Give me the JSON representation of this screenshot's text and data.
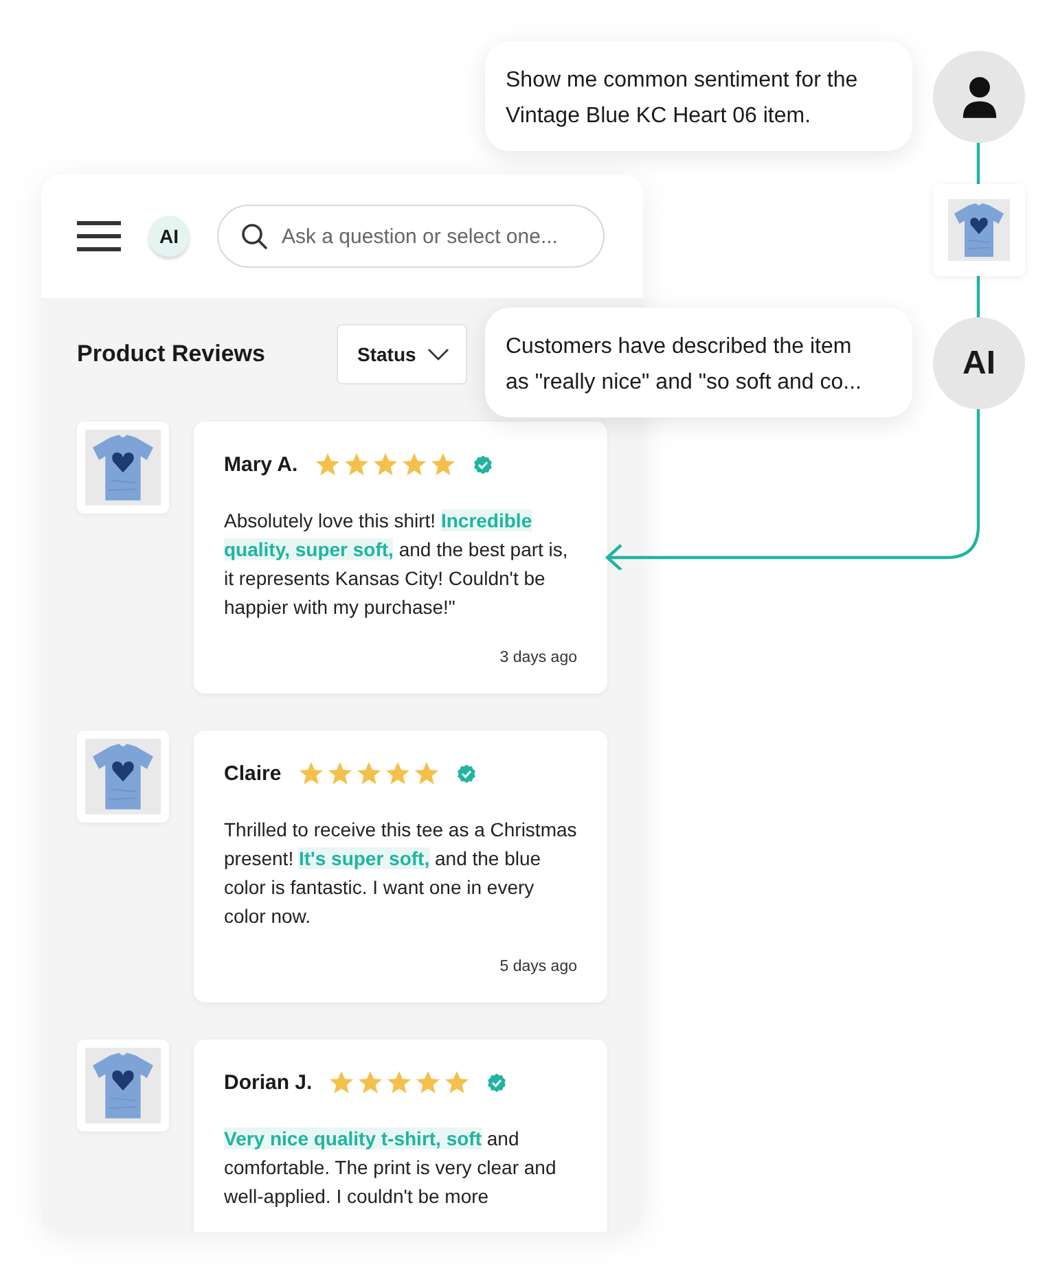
{
  "panel": {
    "search": {
      "placeholder": "Ask a question or select one..."
    },
    "badge": "AI",
    "title": "Product Reviews",
    "filter": {
      "label": "Status"
    },
    "reviews": [
      {
        "name": "Mary A.",
        "stars": 5,
        "verified": true,
        "text": "Absolutely love this shirt! **Incredible quality, super soft,** and the best part is, it represents Kansas City! Couldn't be happier with my purchase!\"",
        "time": "3 days ago"
      },
      {
        "name": "Claire",
        "stars": 5,
        "verified": true,
        "text": "Thrilled to receive this tee as a Christmas present! **It's super soft,** and the blue color is fantastic. I want one in every color now.",
        "time": "5 days ago"
      },
      {
        "name": "Dorian J.",
        "stars": 5,
        "verified": true,
        "text": "**Very nice quality t-shirt, soft** and comfortable. The print is very clear and well-applied. I couldn't be more"
      }
    ]
  },
  "chat": {
    "user_message": "Show me common sentiment for the Vintage Blue KC Heart 06 item.",
    "ai_avatar": "AI",
    "ai_message": "Customers have described the item as \"really nice\" and \"so soft and co..."
  }
}
